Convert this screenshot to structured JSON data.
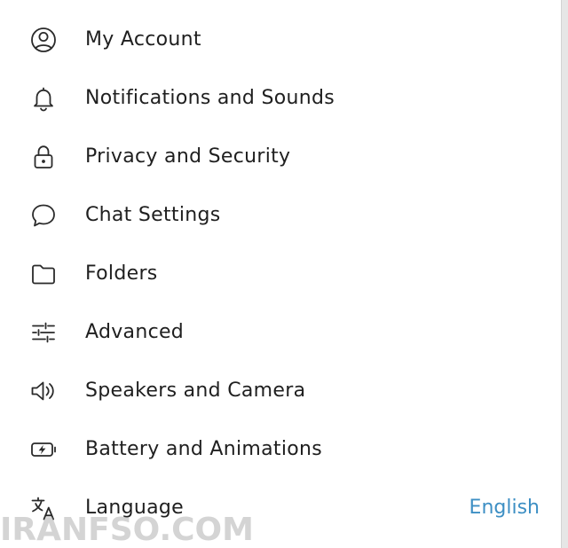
{
  "menu": {
    "items": [
      {
        "label": "My Account",
        "icon": "account-circle-icon"
      },
      {
        "label": "Notifications and Sounds",
        "icon": "bell-icon"
      },
      {
        "label": "Privacy and Security",
        "icon": "lock-icon"
      },
      {
        "label": "Chat Settings",
        "icon": "chat-bubble-icon"
      },
      {
        "label": "Folders",
        "icon": "folder-icon"
      },
      {
        "label": "Advanced",
        "icon": "sliders-icon"
      },
      {
        "label": "Speakers and Camera",
        "icon": "speaker-icon"
      },
      {
        "label": "Battery and Animations",
        "icon": "battery-icon"
      },
      {
        "label": "Language",
        "icon": "translate-icon",
        "value": "English"
      }
    ]
  },
  "watermark": {
    "text": "IRANFSO.COM"
  },
  "colors": {
    "text": "#1f1f1f",
    "icon": "#2a2a2a",
    "accent": "#3d8fc4",
    "background": "#ffffff"
  }
}
